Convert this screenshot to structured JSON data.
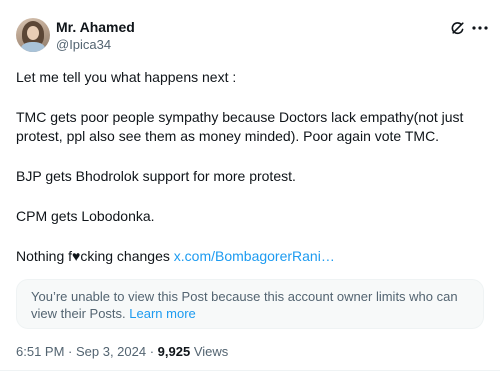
{
  "author": {
    "name": "Mr. Ahamed",
    "handle": "@Ipica34"
  },
  "icons": {
    "grok": "grok-icon",
    "more": "more-options-icon"
  },
  "post": {
    "line1": "Let me tell you what happens next :",
    "line2a": "TMC gets poor people sympathy because Doctors lack empathy(not just",
    "line2b": "protest, ppl also see them as money minded). Poor again vote TMC.",
    "line3": "BJP gets Bhodrolok support for more protest.",
    "line4": "CPM  gets Lobodonka.",
    "line5_prefix": "Nothing f",
    "line5_heart": "♥",
    "line5_suffix": "cking changes ",
    "link": "x.com/BombagorerRani…"
  },
  "notice": {
    "text": "You’re unable to view this Post because this account owner limits who can view their Posts.",
    "learn_more": "Learn more"
  },
  "meta": {
    "time": "6:51 PM",
    "sep1": " · ",
    "date": "Sep 3, 2024",
    "sep2": " · ",
    "views_count": "9,925",
    "views_label": " Views"
  },
  "colors": {
    "text": "#0f1419",
    "secondary": "#536471",
    "link": "#1d9bf0",
    "notice_bg": "#f7f9f9"
  }
}
